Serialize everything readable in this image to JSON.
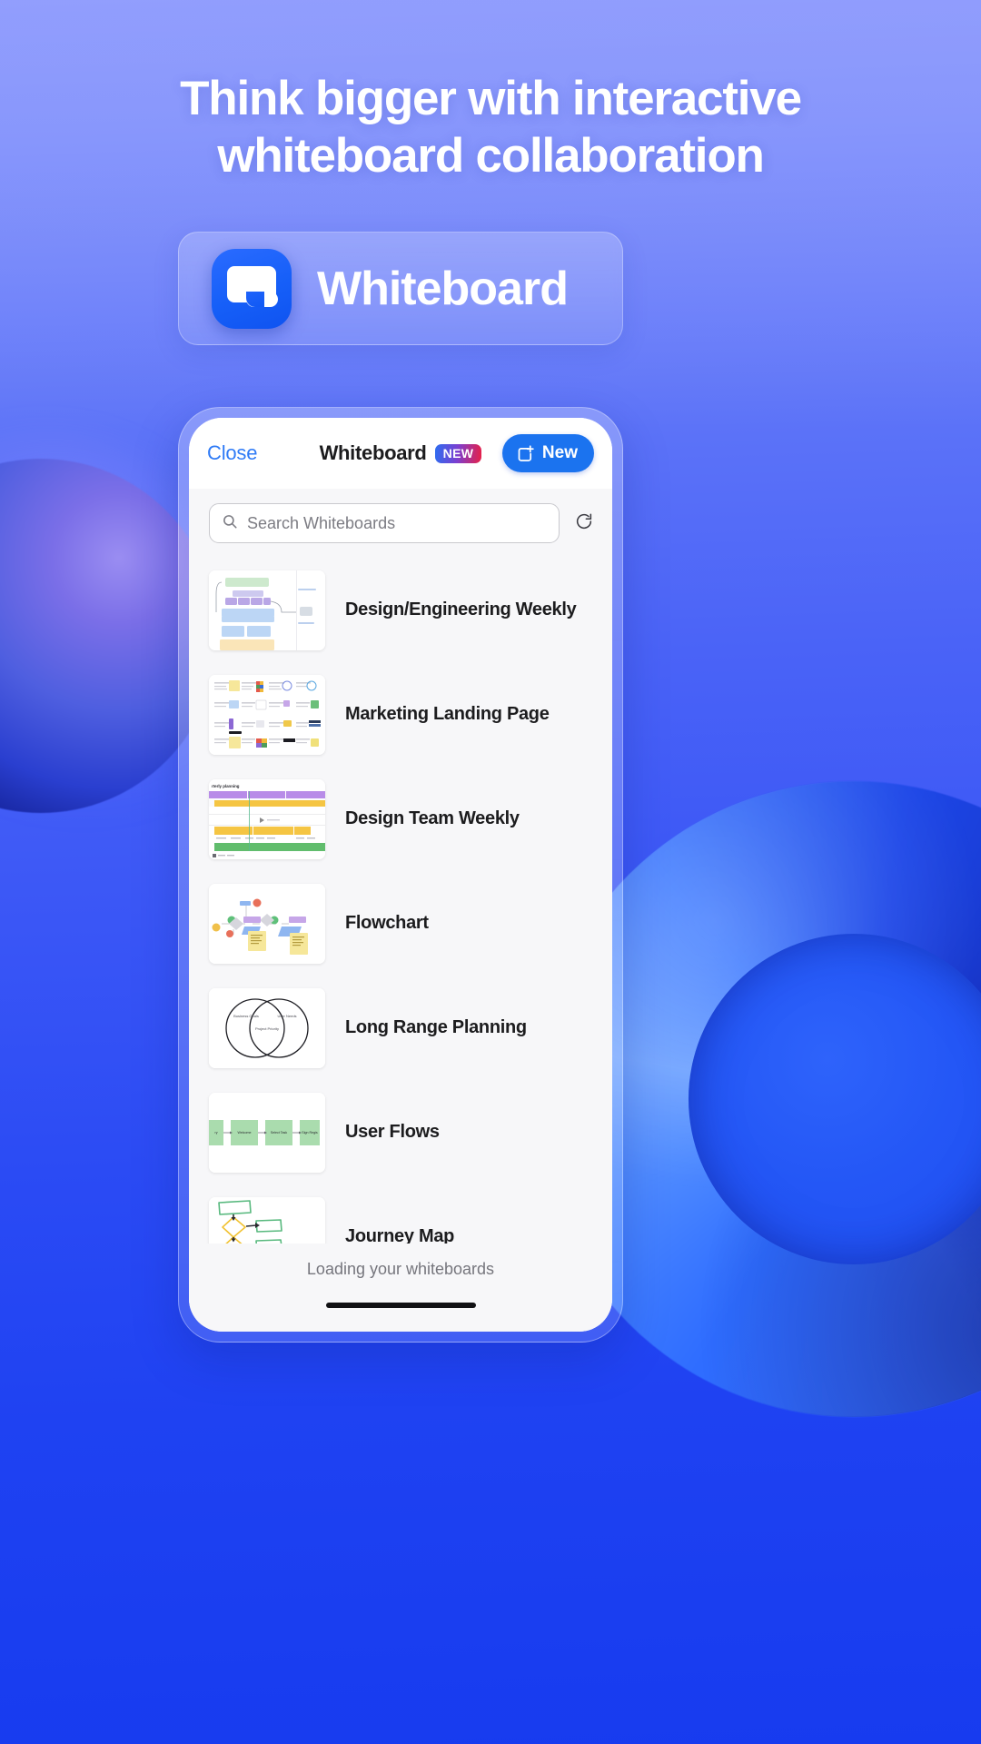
{
  "hero": {
    "headline": "Think bigger with interactive whiteboard collaboration",
    "app_name": "Whiteboard",
    "app_icon": "whiteboard-app-icon",
    "accent_color": "#1b73ef",
    "background_color": "#3d63f5"
  },
  "app": {
    "header": {
      "close_label": "Close",
      "title": "Whiteboard",
      "new_badge": "NEW",
      "new_button_label": "New",
      "new_button_icon": "new-whiteboard-icon"
    },
    "search": {
      "placeholder": "Search Whiteboards",
      "value": "",
      "search_icon": "search-icon",
      "refresh_icon": "refresh-icon"
    },
    "list": [
      {
        "title": "Design/Engineering Weekly",
        "thumbnail": "flow-diagram-thumbnail"
      },
      {
        "title": "Marketing Landing Page",
        "thumbnail": "sticky-note-grid-thumbnail"
      },
      {
        "title": "Design Team Weekly",
        "thumbnail": "gantt-timeline-thumbnail"
      },
      {
        "title": "Flowchart",
        "thumbnail": "flowchart-thumbnail"
      },
      {
        "title": "Long Range Planning",
        "thumbnail": "venn-diagram-thumbnail"
      },
      {
        "title": "User Flows",
        "thumbnail": "user-flow-thumbnail"
      },
      {
        "title": "Journey Map",
        "thumbnail": "journey-map-thumbnail"
      }
    ],
    "footer_status": "Loading your whiteboards",
    "thumbnail_labels": {
      "gantt_title": "rterly planning",
      "venn_left": "Business Goals",
      "venn_right": "User Needs",
      "venn_center": "Project Priority",
      "flow_nodes": [
        "ry",
        "Welcome",
        "Select Task",
        "Sign Regis"
      ]
    }
  }
}
